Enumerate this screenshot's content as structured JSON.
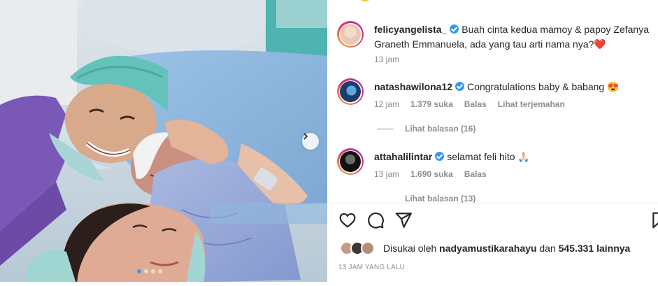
{
  "post": {
    "image_alt": "Newborn baby with parents in hospital",
    "carousel": {
      "slide_count": 4,
      "active_slide": 1
    }
  },
  "comments": [
    {
      "username": "felicyangelista_",
      "verified": true,
      "text": "Buah cinta kedua mamoy & papoy Zefanya Graneth Emmanuela, ada yang tau arti nama nya?",
      "emoji": "❤️",
      "time": "13 jam"
    },
    {
      "username": "natashawilona12",
      "verified": true,
      "text": "Congratulations baby & babang",
      "emoji": "😍",
      "time": "12 jam",
      "likes": "1.379 suka",
      "reply": "Balas",
      "translate": "Lihat terjemahan",
      "view_replies": "Lihat balasan (16)"
    },
    {
      "username": "attahalilintar",
      "verified": true,
      "text": "selamat feli hito",
      "emoji": "🙏🏻",
      "time": "13 jam",
      "likes": "1.690 suka",
      "reply": "Balas",
      "view_replies": "Lihat balasan (13)"
    }
  ],
  "footer": {
    "liked_by_prefix": "Disukai oleh",
    "liked_by_user": "nadyamustikarahayu",
    "liked_by_and": "dan",
    "liked_by_count": "545.331 lainnya",
    "time_ago": "13 JAM YANG LALU"
  },
  "colors": {
    "verified": "#3897f0",
    "text": "#262626",
    "muted": "#8e8e8e",
    "story_ring_start": "#f9c33a",
    "story_ring_end": "#9b36b7"
  }
}
